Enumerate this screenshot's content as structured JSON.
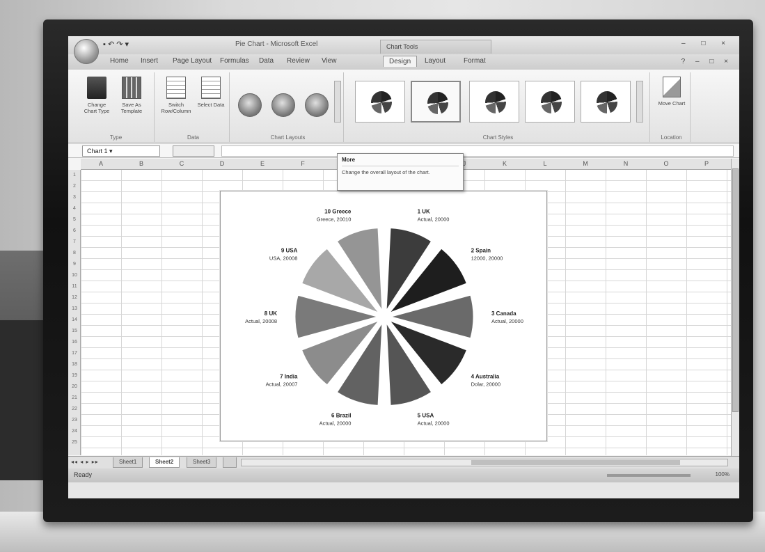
{
  "window": {
    "quick_access": "▪ ↶ ↷ ▾",
    "title": "Pie Chart - Microsoft Excel",
    "context_tab_title": "Chart Tools",
    "controls": "– □ ×"
  },
  "ribbon": {
    "tabs": [
      "Home",
      "Insert",
      "Page Layout",
      "Formulas",
      "Data",
      "Review",
      "View",
      "Design",
      "Layout",
      "Format"
    ],
    "active_tab": "Design",
    "right_controls": "? – □ ×",
    "groups": {
      "type": {
        "label": "Type",
        "buttons": [
          "Change Chart Type",
          "Save As Template"
        ]
      },
      "data": {
        "label": "Data",
        "buttons": [
          "Switch Row/Column",
          "Select Data"
        ]
      },
      "layouts": {
        "label": "Chart Layouts"
      },
      "styles": {
        "label": "Chart Styles"
      },
      "location": {
        "label": "Location",
        "buttons": [
          "Move Chart"
        ]
      }
    }
  },
  "formula_bar": {
    "name_box": "Chart 1",
    "fx": "fx"
  },
  "tooltip": {
    "title": "More",
    "body": "Change the overall layout of the chart."
  },
  "grid": {
    "columns": [
      "A",
      "B",
      "C",
      "D",
      "E",
      "F",
      "G",
      "H",
      "I",
      "J",
      "K",
      "L",
      "M",
      "N",
      "O",
      "P"
    ],
    "rows": [
      "1",
      "2",
      "3",
      "4",
      "5",
      "6",
      "7",
      "8",
      "9",
      "10",
      "11",
      "12",
      "13",
      "14",
      "15",
      "16",
      "17",
      "18",
      "19",
      "20",
      "21",
      "22",
      "23",
      "24",
      "25"
    ]
  },
  "chart_data": {
    "type": "pie",
    "exploded": true,
    "slices": [
      {
        "label": "1 UK",
        "sublabel": "Actual, 20000",
        "value": 20000,
        "color": "#3c3c3c"
      },
      {
        "label": "2 Spain",
        "sublabel": "12000, 20000",
        "value": 20000,
        "color": "#1e1e1e"
      },
      {
        "label": "3 Canada",
        "sublabel": "Actual, 20000",
        "value": 20000,
        "color": "#6a6a6a"
      },
      {
        "label": "4 Australia",
        "sublabel": "Dolar, 20000",
        "value": 20000,
        "color": "#2a2a2a"
      },
      {
        "label": "5 USA",
        "sublabel": "Actual, 20000",
        "value": 20000,
        "color": "#555555"
      },
      {
        "label": "6 Brazil",
        "sublabel": "Actual, 20000",
        "value": 20000,
        "color": "#626262"
      },
      {
        "label": "7 India",
        "sublabel": "Actual, 20007",
        "value": 20007,
        "color": "#8c8c8c"
      },
      {
        "label": "8 UK",
        "sublabel": "Actual, 20008",
        "value": 20008,
        "color": "#7a7a7a"
      },
      {
        "label": "9 USA",
        "sublabel": "USA, 20008",
        "value": 20008,
        "color": "#a8a8a8"
      },
      {
        "label": "10 Greece",
        "sublabel": "Greece, 20010",
        "value": 20010,
        "color": "#959595"
      }
    ]
  },
  "sheet_tabs": {
    "nav": "◂◂ ◂ ▸ ▸▸",
    "tabs": [
      "Sheet1",
      "Sheet2",
      "Sheet3"
    ],
    "active": "Sheet2"
  },
  "status": {
    "text": "Ready",
    "zoom": "100%"
  }
}
